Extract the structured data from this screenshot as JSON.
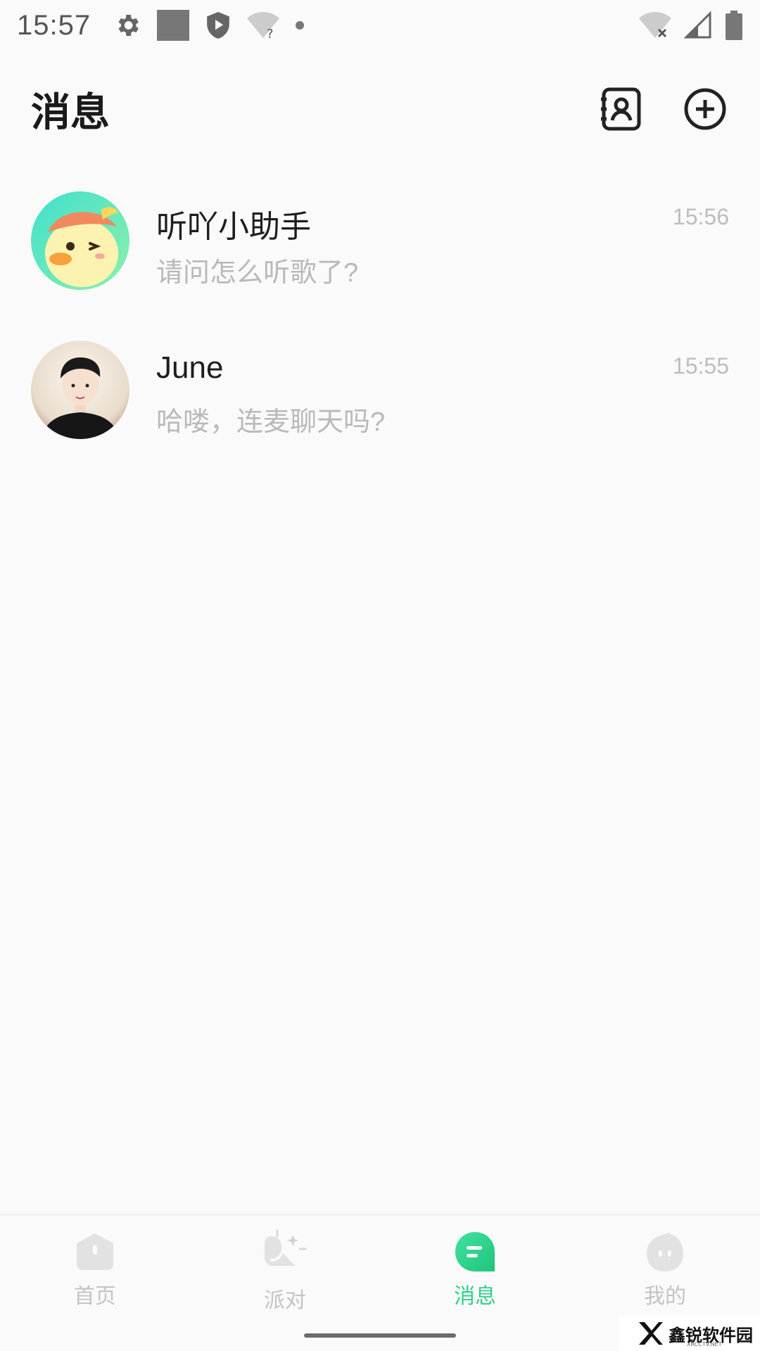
{
  "status_bar": {
    "time": "15:57"
  },
  "header": {
    "title": "消息"
  },
  "conversations": [
    {
      "name": "听吖小助手",
      "preview": "请问怎么听歌了?",
      "time": "15:56",
      "avatar_icon": "duck-mascot-icon"
    },
    {
      "name": "June",
      "preview": "哈喽，连麦聊天吗?",
      "time": "15:55",
      "avatar_icon": "user-portrait-icon"
    }
  ],
  "bottom_nav": {
    "items": [
      {
        "label": "首页",
        "icon": "home-icon",
        "active": false
      },
      {
        "label": "派对",
        "icon": "party-icon",
        "active": false
      },
      {
        "label": "消息",
        "icon": "message-icon",
        "active": true
      },
      {
        "label": "我的",
        "icon": "profile-icon",
        "active": false
      }
    ]
  },
  "watermark": {
    "text": "鑫锐软件园",
    "sub": "XRCCTV.NET"
  },
  "colors": {
    "accent": "#2fd08a",
    "background": "#fafafa",
    "inactive": "#c4c4c4"
  }
}
